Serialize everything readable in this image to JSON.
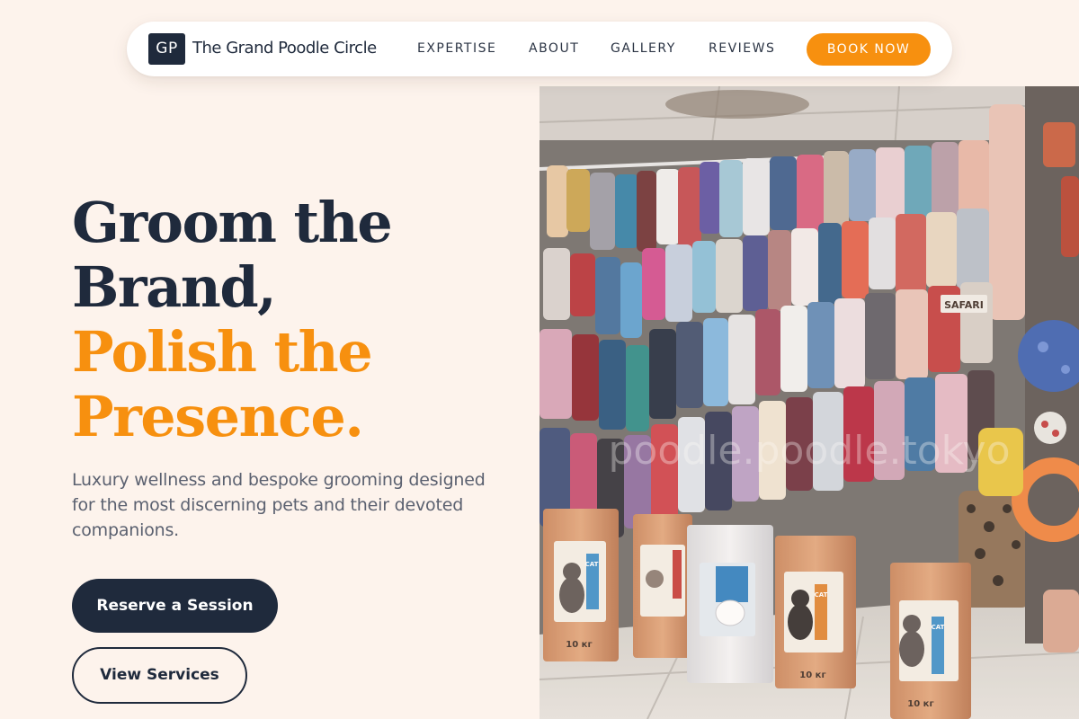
{
  "nav": {
    "logo_mark": "GP",
    "brand_name": "The Grand Poodle Circle",
    "links": [
      {
        "label": "EXPERTISE"
      },
      {
        "label": "ABOUT"
      },
      {
        "label": "GALLERY"
      },
      {
        "label": "REVIEWS"
      }
    ],
    "cta_label": "BOOK NOW"
  },
  "hero": {
    "title_lines": [
      "Groom the",
      "Brand,"
    ],
    "title_accent_lines": [
      "Polish the",
      "Presence."
    ],
    "subtitle": "Luxury wellness and bespoke grooming designed for the most discerning pets and their devoted companions.",
    "primary_cta": "Reserve a Session",
    "secondary_cta": "View Services"
  },
  "image": {
    "shop_sign": "SAFARI",
    "bag_weight_label": "10 кг",
    "bag_label": "CAT",
    "watermark": "poodle.poodle.tokyo"
  },
  "colors": {
    "background": "#fdf3ec",
    "navy": "#1f2a3c",
    "accent_orange": "#f7900f",
    "muted_text": "#5b6170"
  }
}
